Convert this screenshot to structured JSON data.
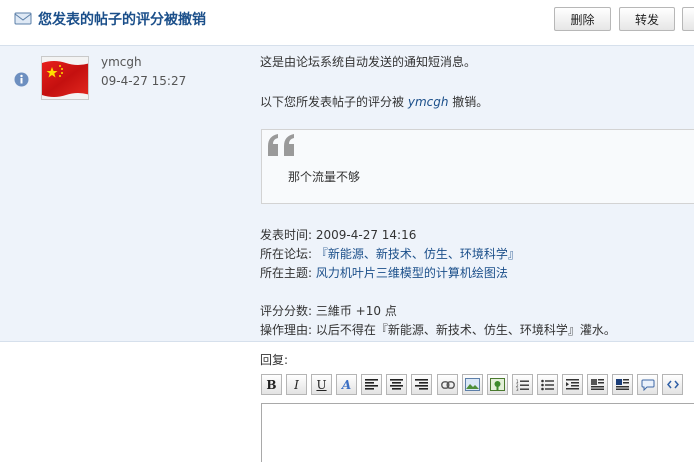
{
  "header": {
    "title": "您发表的帖子的评分被撤销",
    "delete_label": "删除",
    "forward_label": "转发"
  },
  "message": {
    "sender": "ymcgh",
    "time": "09-4-27 15:27",
    "intro": "这是由论坛系统自动发送的通知短消息。",
    "revoke_prefix": "以下您所发表帖子的评分被",
    "revoke_user": "ymcgh",
    "revoke_suffix": "撤销。",
    "quote_text": "那个流量不够",
    "post_time_label": "发表时间: ",
    "post_time": "2009-4-27 14:16",
    "forum_label": "所在论坛: ",
    "forum": "『新能源、新技术、仿生、环境科学』",
    "topic_label": "所在主题: ",
    "topic": "风力机叶片三维模型的计算机绘图法",
    "score_label": "评分分数: ",
    "score": "三維币  +10 点",
    "reason_label": "操作理由: ",
    "reason": "以后不得在『新能源、新技术、仿生、环境科学』灌水。"
  },
  "reply": {
    "label": "回复:"
  },
  "toolbar_icons": [
    "bold-icon",
    "italic-icon",
    "underline-icon",
    "font-color-icon",
    "align-left-icon",
    "align-center-icon",
    "align-right-icon",
    "link-icon",
    "image-icon",
    "attach-image-icon",
    "ordered-list-icon",
    "unordered-list-icon",
    "indent-icon",
    "float-left-icon",
    "float-right-icon",
    "quote-icon",
    "code-icon"
  ],
  "colors": {
    "accent": "#1b4f8a",
    "panel": "#eef3fa"
  }
}
